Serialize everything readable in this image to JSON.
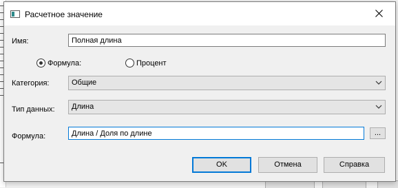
{
  "dialog": {
    "title": "Расчетное значение",
    "name_label": "Имя:",
    "name_value": "Полная длина",
    "radio_formula_label": "Формула:",
    "radio_percent_label": "Процент",
    "radio_selected": "formula",
    "category_label": "Категория:",
    "category_value": "Общие",
    "datatype_label": "Тип данных:",
    "datatype_value": "Длина",
    "formula_label": "Формула:",
    "formula_value": "Длина / Доля по длине",
    "browse_label": "...",
    "ok_label": "OK",
    "cancel_label": "Отмена",
    "help_label": "Справка"
  },
  "icons": {
    "title": "window-icon",
    "close": "close-icon",
    "dropdown": "chevron-down-icon"
  },
  "colors": {
    "focus_accent": "#0078d7",
    "dialog_bg": "#f0f0f0",
    "button_bg": "#e1e1e1"
  }
}
